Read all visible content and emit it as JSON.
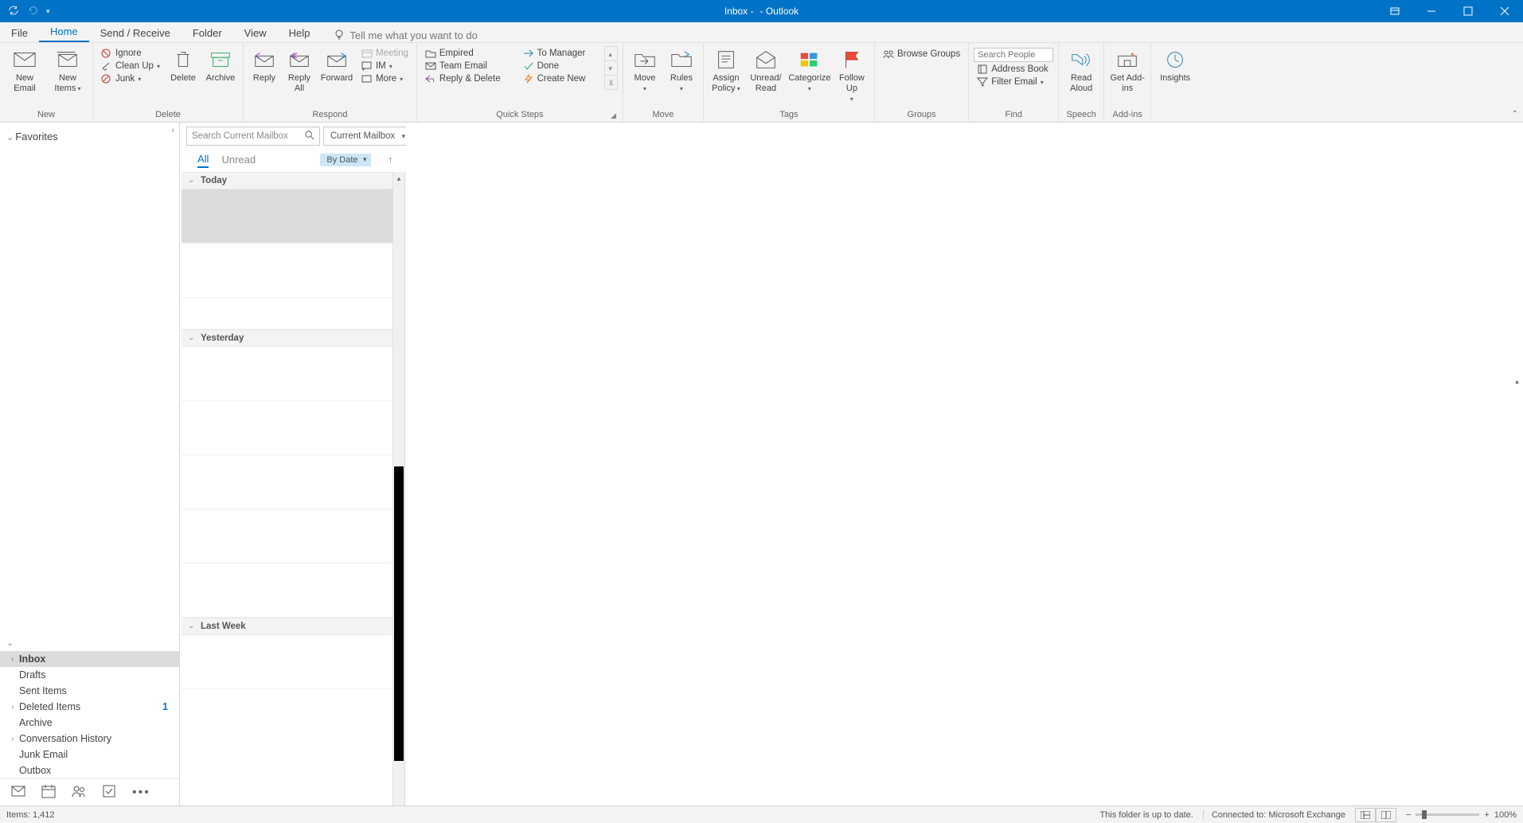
{
  "title": {
    "folder": "Inbox -",
    "app": "- Outlook"
  },
  "menutabs": [
    "File",
    "Home",
    "Send / Receive",
    "Folder",
    "View",
    "Help"
  ],
  "tellme": "Tell me what you want to do",
  "ribbon": {
    "new": {
      "email": "New Email",
      "items": "New Items",
      "label": "New"
    },
    "delete": {
      "ignore": "Ignore",
      "cleanup": "Clean Up",
      "junk": "Junk",
      "delete": "Delete",
      "archive": "Archive",
      "label": "Delete"
    },
    "respond": {
      "reply": "Reply",
      "replyall": "Reply All",
      "forward": "Forward",
      "meeting": "Meeting",
      "im": "IM",
      "more": "More",
      "label": "Respond"
    },
    "quick": {
      "empired": "Empired",
      "team": "Team Email",
      "replydel": "Reply & Delete",
      "tomgr": "To Manager",
      "done": "Done",
      "create": "Create New",
      "label": "Quick Steps"
    },
    "move": {
      "move": "Move",
      "rules": "Rules",
      "label": "Move"
    },
    "tags": {
      "assign": "Assign Policy",
      "unread": "Unread/ Read",
      "categorize": "Categorize",
      "followup": "Follow Up",
      "label": "Tags"
    },
    "groups": {
      "browse": "Browse Groups",
      "label": "Groups"
    },
    "find": {
      "search_ph": "Search People",
      "addr": "Address Book",
      "filter": "Filter Email",
      "label": "Find"
    },
    "speech": {
      "read": "Read Aloud",
      "label": "Speech"
    },
    "addins": {
      "get": "Get Add-ins",
      "label": "Add-ins"
    },
    "insights": {
      "btn": "Insights"
    }
  },
  "search": {
    "placeholder": "Search Current Mailbox",
    "scope": "Current Mailbox"
  },
  "filter": {
    "all": "All",
    "unread": "Unread",
    "bydate": "By Date"
  },
  "nav": {
    "favorites": "Favorites",
    "folders": [
      {
        "name": "Inbox",
        "caret": true,
        "sel": true
      },
      {
        "name": "Drafts"
      },
      {
        "name": "Sent Items"
      },
      {
        "name": "Deleted Items",
        "caret": true,
        "count": "1"
      },
      {
        "name": "Archive"
      },
      {
        "name": "Conversation History",
        "caret": true
      },
      {
        "name": "Junk Email"
      },
      {
        "name": "Outbox"
      }
    ]
  },
  "msggroups": [
    "Today",
    "Yesterday",
    "Last Week"
  ],
  "status": {
    "items": "Items: 1,412",
    "sync": "This folder is up to date.",
    "conn": "Connected to: Microsoft Exchange",
    "zoom": "100%"
  }
}
